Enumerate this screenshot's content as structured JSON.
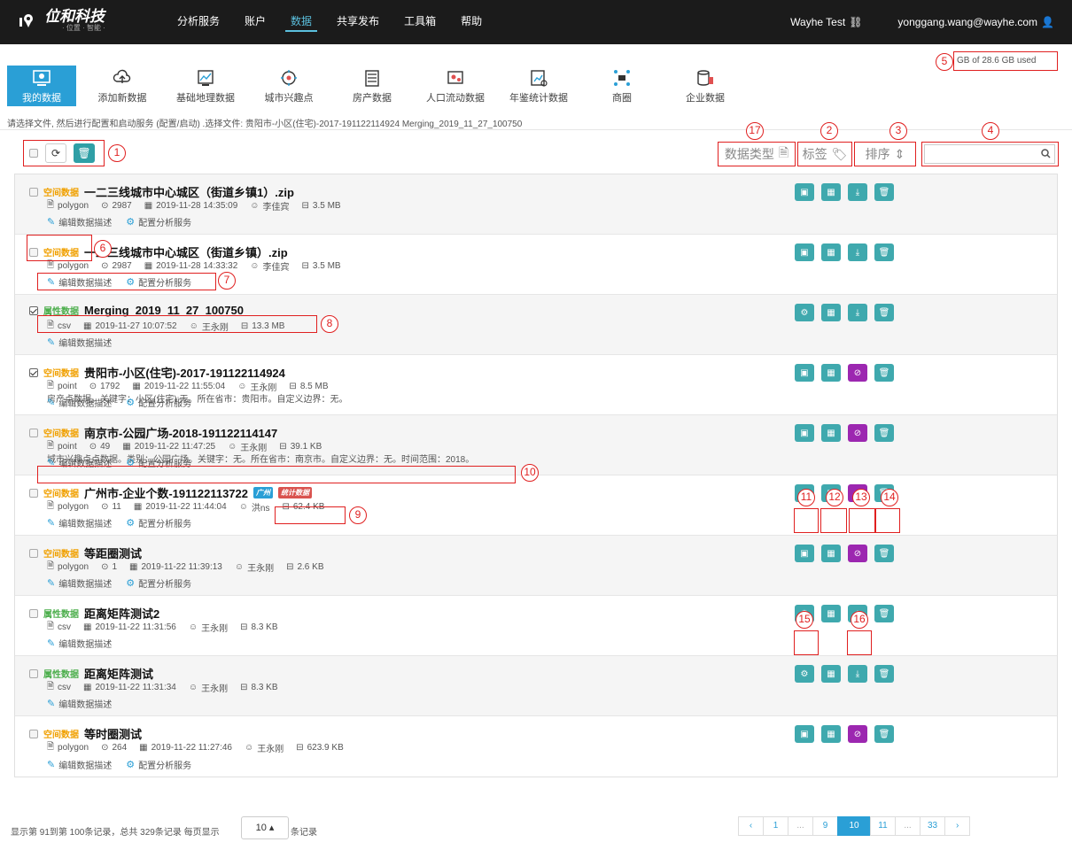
{
  "brand": {
    "name": "位和科技",
    "sub": "· 位置 · 智能 ·"
  },
  "nav": {
    "items": [
      "分析服务",
      "账户",
      "数据",
      "共享发布",
      "工具箱",
      "帮助"
    ],
    "user": "Wayhe Test",
    "email": "yonggang.wang@wayhe.com"
  },
  "storage": "GB of 28.6 GB used",
  "tiles": [
    "我的数据",
    "添加新数据",
    "基础地理数据",
    "城市兴趣点",
    "房产数据",
    "人口流动数据",
    "年鉴统计数据",
    "商圈",
    "企业数据"
  ],
  "hint": "请选择文件, 然后进行配置和启动服务 (配置/启动) .选择文件:  贵阳市-小区(住宅)-2017-191122114924   Merging_2019_11_27_100750",
  "toolbar": {
    "data_type": "数据类型",
    "tags": "标签",
    "sort": "排序",
    "search_placeholder": ""
  },
  "link_labels": {
    "edit": "编辑数据描述",
    "config": "配置分析服务"
  },
  "rows": [
    {
      "tag": "空间数据",
      "name": "一二三线城市中心城区（街道乡镇1）.zip",
      "type": "polygon",
      "count": "2987",
      "date": "2019-11-28 14:35:09",
      "user": "李佳宾",
      "size": "3.5 MB"
    },
    {
      "tag": "空间数据",
      "name": "一二三线城市中心城区（街道乡镇）.zip",
      "type": "polygon",
      "count": "2987",
      "date": "2019-11-28 14:33:32",
      "user": "李佳宾",
      "size": "3.5 MB"
    },
    {
      "tag": "属性数据",
      "name": "Merging_2019_11_27_100750",
      "type": "csv",
      "date": "2019-11-27 10:07:52",
      "user": "王永刚",
      "size": "13.3 MB"
    },
    {
      "tag": "空间数据",
      "name": "贵阳市-小区(住宅)-2017-191122114924",
      "type": "point",
      "count": "1792",
      "date": "2019-11-22 11:55:04",
      "user": "王永刚",
      "size": "8.5 MB",
      "desc": "房产点数据。关键字：小区(住宅):无。所在省市：贵阳市。自定义边界：无。"
    },
    {
      "tag": "空间数据",
      "name": "南京市-公园广场-2018-191122114147",
      "type": "point",
      "count": "49",
      "date": "2019-11-22 11:47:25",
      "user": "王永刚",
      "size": "39.1 KB",
      "desc": "城市兴趣点点数据。类别：公园广场。关键字：无。所在省市：南京市。自定义边界：无。时间范围：2018。"
    },
    {
      "tag": "空间数据",
      "name": "广州市-企业个数-191122113722",
      "badges": [
        "广州",
        "统计数据"
      ],
      "type": "polygon",
      "count": "11",
      "date": "2019-11-22 11:44:04",
      "user": "洪ns",
      "size": "62.4 KB"
    },
    {
      "tag": "空间数据",
      "name": "等距圈测试",
      "type": "polygon",
      "count": "1",
      "date": "2019-11-22 11:39:13",
      "user": "王永刚",
      "size": "2.6 KB"
    },
    {
      "tag": "属性数据",
      "name": "距离矩阵测试2",
      "type": "csv",
      "date": "2019-11-22 11:31:56",
      "user": "王永刚",
      "size": "8.3 KB"
    },
    {
      "tag": "属性数据",
      "name": "距离矩阵测试",
      "type": "csv",
      "date": "2019-11-22 11:31:34",
      "user": "王永刚",
      "size": "8.3 KB"
    },
    {
      "tag": "空间数据",
      "name": "等时圈测试",
      "type": "polygon",
      "count": "264",
      "date": "2019-11-22 11:27:46",
      "user": "王永刚",
      "size": "623.9 KB"
    }
  ],
  "footer": {
    "text": "显示第 91到第 100条记录，总共 329条记录 每页显示",
    "page_size": "10 ▴",
    "after": "条记录"
  },
  "pager": [
    "‹",
    "1",
    "...",
    "9",
    "10",
    "11",
    "...",
    "33",
    "›"
  ],
  "annotations": [
    "1",
    "2",
    "3",
    "4",
    "5",
    "6",
    "7",
    "8",
    "9",
    "10",
    "11",
    "12",
    "13",
    "14",
    "15",
    "16",
    "17"
  ],
  "colors": {
    "accent": "#2a9fd6",
    "teal": "#3fa9ae",
    "purple": "#9c27b0",
    "annotation": "#e02020"
  }
}
